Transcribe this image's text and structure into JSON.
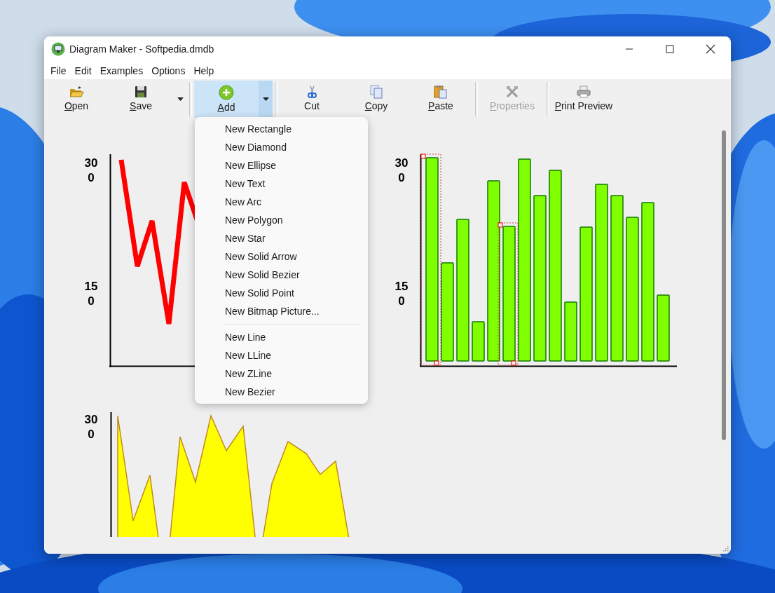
{
  "window": {
    "title": "Diagram Maker - Softpedia.dmdb"
  },
  "menu_bar": [
    "File",
    "Edit",
    "Examples",
    "Options",
    "Help"
  ],
  "toolbar": [
    {
      "kind": "button",
      "label": "Open",
      "mnemonic": true,
      "active": false,
      "disabled": false
    },
    {
      "kind": "button",
      "label": "Save",
      "mnemonic": true,
      "active": false,
      "disabled": false
    },
    {
      "kind": "dropdown",
      "active": false
    },
    {
      "kind": "separator"
    },
    {
      "kind": "button",
      "label": "Add",
      "mnemonic": true,
      "active": true,
      "disabled": false
    },
    {
      "kind": "dropdown",
      "active": true
    },
    {
      "kind": "separator"
    },
    {
      "kind": "button",
      "label": "Cut",
      "mnemonic": false,
      "active": false,
      "disabled": false
    },
    {
      "kind": "button",
      "label": "Copy",
      "mnemonic": true,
      "active": false,
      "disabled": false
    },
    {
      "kind": "button",
      "label": "Paste",
      "mnemonic": true,
      "active": false,
      "disabled": false
    },
    {
      "kind": "separator"
    },
    {
      "kind": "button",
      "label": "Properties",
      "mnemonic": true,
      "active": false,
      "disabled": true
    },
    {
      "kind": "separator"
    },
    {
      "kind": "button",
      "label": "Print Preview",
      "mnemonic": true,
      "active": false,
      "disabled": false
    }
  ],
  "popup_menu": {
    "groups": [
      [
        "New Rectangle",
        "New Diamond",
        "New Ellipse",
        "New Text",
        "New Arc",
        "New Polygon",
        "New Star",
        "New Solid Arrow",
        "New Solid Bezier",
        "New Solid Point",
        "New Bitmap Picture..."
      ],
      [
        "New Line",
        "New LLine",
        "New ZLine",
        "New Bezier"
      ]
    ]
  },
  "canvas": {
    "charts": [
      {
        "kind": "line",
        "tick_labels": [
          "30\n0",
          "15\n0"
        ]
      },
      {
        "kind": "bar",
        "tick_labels": [
          "30\n0",
          "15\n0"
        ]
      },
      {
        "kind": "area",
        "tick_labels": [
          "30\n0"
        ]
      }
    ]
  }
}
